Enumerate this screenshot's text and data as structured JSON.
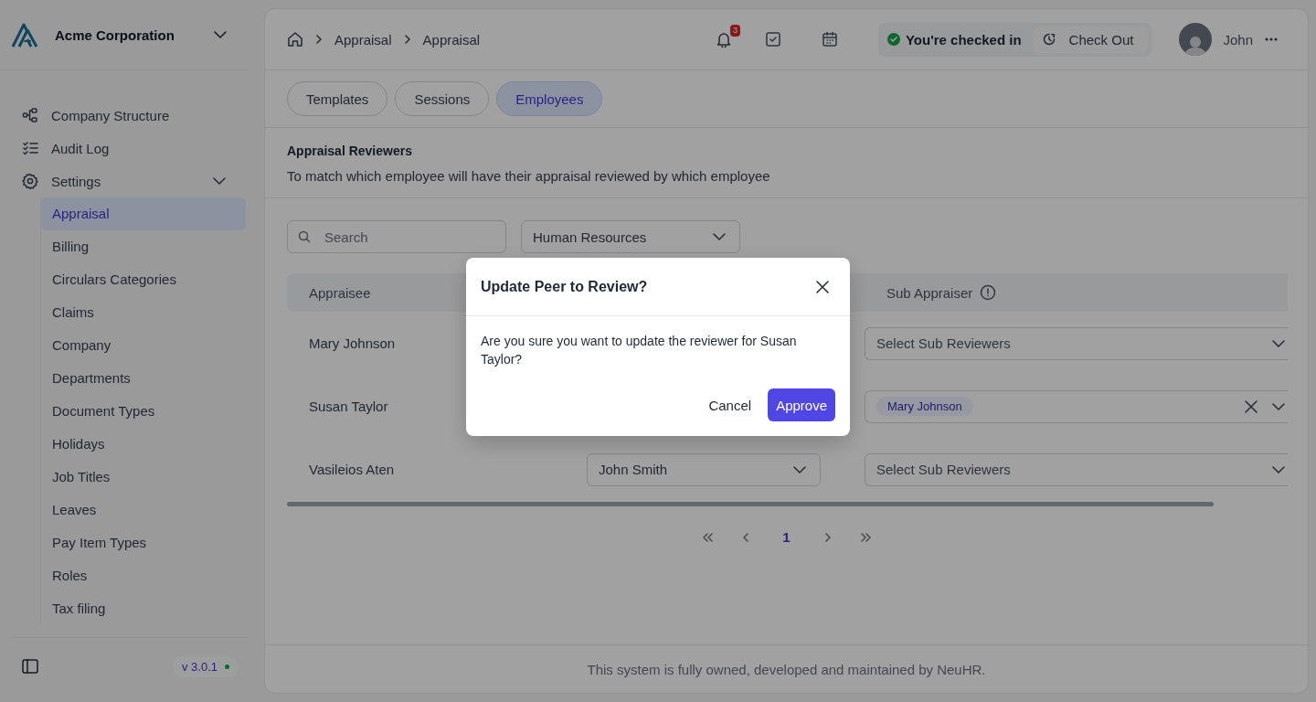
{
  "sidebar": {
    "company": "Acme Corporation",
    "items": [
      {
        "label": "Company Structure",
        "kind": "structure"
      },
      {
        "label": "Audit Log",
        "kind": "checklist"
      },
      {
        "label": "Settings",
        "kind": "gear",
        "expanded": true,
        "children": [
          {
            "label": "Appraisal",
            "selected": true
          },
          {
            "label": "Billing",
            "selected": false
          },
          {
            "label": "Circulars Categories",
            "selected": false
          },
          {
            "label": "Claims",
            "selected": false
          },
          {
            "label": "Company",
            "selected": false
          },
          {
            "label": "Departments",
            "selected": false
          },
          {
            "label": "Document Types",
            "selected": false
          },
          {
            "label": "Holidays",
            "selected": false
          },
          {
            "label": "Job Titles",
            "selected": false
          },
          {
            "label": "Leaves",
            "selected": false
          },
          {
            "label": "Pay Item Types",
            "selected": false
          },
          {
            "label": "Roles",
            "selected": false
          },
          {
            "label": "Tax filing",
            "selected": false
          }
        ]
      }
    ],
    "version": "v 3.0.1"
  },
  "header": {
    "breadcrumb": [
      "Appraisal",
      "Appraisal"
    ],
    "notification_count": "3",
    "check_status": "You're checked in",
    "check_out": "Check Out",
    "user": "John"
  },
  "tabs": [
    {
      "label": "Templates",
      "selected": false
    },
    {
      "label": "Sessions",
      "selected": false
    },
    {
      "label": "Employees",
      "selected": true
    }
  ],
  "section": {
    "title": "Appraisal Reviewers",
    "description": "To match which employee will have their appraisal reviewed by which employee"
  },
  "filters": {
    "search": {
      "placeholder": "Search"
    },
    "department": "Human Resources"
  },
  "table": {
    "columns": [
      "Appraisee",
      "Sub Appraiser"
    ],
    "rows": [
      {
        "appraisee": "Mary Johnson",
        "sub_placeholder": "Select Sub Reviewers"
      },
      {
        "appraisee": "Susan Taylor",
        "sub_reviewers": [
          "Mary Johnson"
        ]
      },
      {
        "appraisee": "Vasileios Aten",
        "appraiser": "John Smith",
        "sub_placeholder": "Select Sub Reviewers"
      }
    ]
  },
  "pagination": {
    "pages": [
      {
        "label": "1",
        "selected": true
      }
    ]
  },
  "footer": "This system is fully owned, developed and maintained by NeuHR.",
  "dialog": {
    "title": "Update Peer to Review?",
    "message": "Are you sure you want to update the reviewer for Susan Taylor?",
    "cancel": "Cancel",
    "confirm": "Approve"
  }
}
